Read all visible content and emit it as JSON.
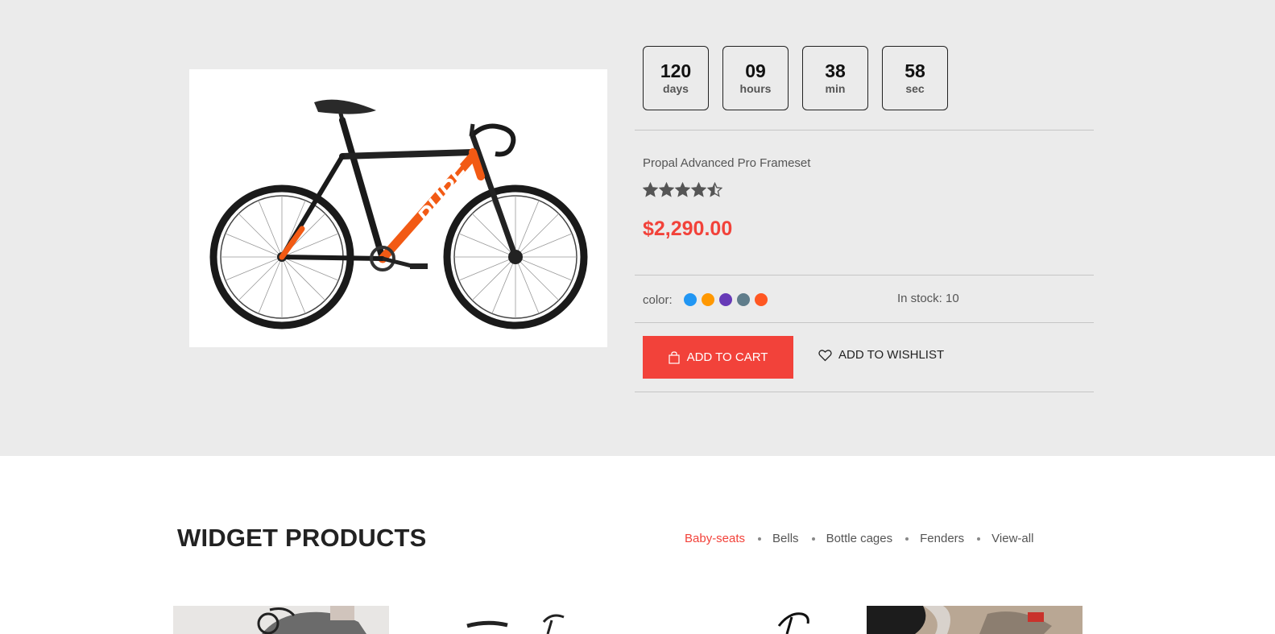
{
  "countdown": [
    {
      "value": "120",
      "unit": "days"
    },
    {
      "value": "09",
      "unit": "hours"
    },
    {
      "value": "38",
      "unit": "min"
    },
    {
      "value": "58",
      "unit": "sec"
    }
  ],
  "product": {
    "name": "Propal Advanced Pro Frameset",
    "rating": 4.5,
    "price": "$2,290.00",
    "color_label": "color:",
    "colors": [
      "#2196f3",
      "#ff9800",
      "#673ab7",
      "#607d8b",
      "#ff5722"
    ],
    "stock": "In stock: 10",
    "frame_text": "PURE"
  },
  "actions": {
    "add_to_cart": "ADD TO CART",
    "add_to_wishlist": "ADD TO WISHLIST"
  },
  "widget": {
    "title": "WIDGET PRODUCTS",
    "tabs": [
      "Baby-seats",
      "Bells",
      "Bottle cages",
      "Fenders",
      "View-all"
    ],
    "active_tab": 0
  },
  "theme": {
    "accent": "#f2423a",
    "deal_bg": "#ebebeb"
  }
}
